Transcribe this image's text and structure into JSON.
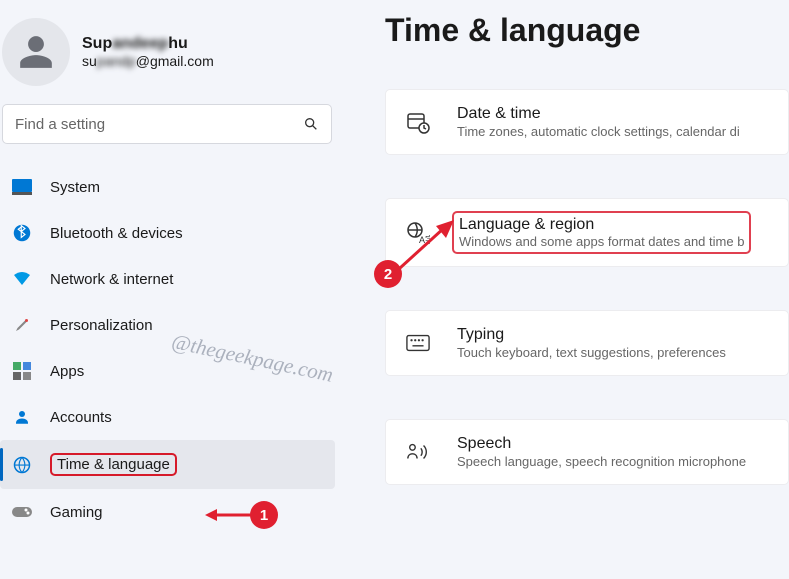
{
  "profile": {
    "name_prefix": "Sup",
    "name_blur": "andeep",
    "name_suffix": "hu",
    "email_prefix": "su",
    "email_blur": "pandp",
    "email_suffix": "@gmail.com"
  },
  "search": {
    "placeholder": "Find a setting"
  },
  "nav": {
    "items": [
      {
        "label": "System"
      },
      {
        "label": "Bluetooth & devices"
      },
      {
        "label": "Network & internet"
      },
      {
        "label": "Personalization"
      },
      {
        "label": "Apps"
      },
      {
        "label": "Accounts"
      },
      {
        "label": "Time & language"
      },
      {
        "label": "Gaming"
      }
    ]
  },
  "page": {
    "title": "Time & language"
  },
  "cards": {
    "date_time": {
      "title": "Date & time",
      "sub": "Time zones, automatic clock settings, calendar di"
    },
    "language_region": {
      "title": "Language & region",
      "sub": "Windows and some apps format dates and time b"
    },
    "typing": {
      "title": "Typing",
      "sub": "Touch keyboard, text suggestions, preferences"
    },
    "speech": {
      "title": "Speech",
      "sub": "Speech language, speech recognition microphone"
    }
  },
  "annotations": {
    "badge1": "1",
    "badge2": "2"
  },
  "watermark": "@thegeekpage.com"
}
